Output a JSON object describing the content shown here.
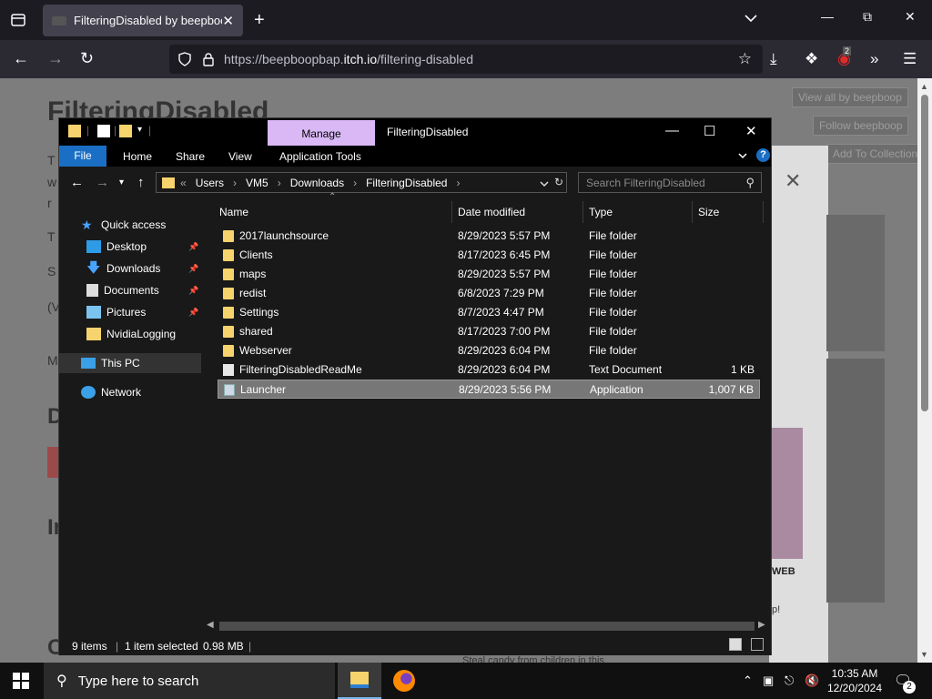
{
  "browser": {
    "tab_title": "FilteringDisabled by beepboop",
    "tab_close": "✕",
    "new_tab": "+",
    "url_prefix": "https://beepboopbap.",
    "url_host": "itch.io",
    "url_path": "/filtering-disabled",
    "extension_badge": "2"
  },
  "webpage": {
    "heading": "FilteringDisabled",
    "view_all_button": "View all by beepboop",
    "follow_button": "Follow beepboop",
    "add_collection_button": "Add To Collection",
    "modal_close": "✕",
    "web_label": "WEB",
    "letters": [
      "T",
      "w",
      "r",
      "T",
      "S",
      "(V",
      "M"
    ],
    "big_letters": [
      "D",
      "In",
      "C"
    ],
    "text_fragment": "p!",
    "footer_text": "Steal candy from children in this"
  },
  "explorer": {
    "window_title": "FilteringDisabled",
    "manage_label": "Manage",
    "ribbon_tabs": {
      "file": "File",
      "home": "Home",
      "share": "Share",
      "view": "View",
      "application_tools": "Application Tools"
    },
    "help": "?",
    "address": {
      "prefix": "«",
      "segments": [
        "Users",
        "VM5",
        "Downloads",
        "FilteringDisabled"
      ],
      "separator": "›"
    },
    "search_placeholder": "Search FilteringDisabled",
    "nav": {
      "quick_access": "Quick access",
      "desktop": "Desktop",
      "downloads": "Downloads",
      "documents": "Documents",
      "pictures": "Pictures",
      "nvidia_logging": "NvidiaLogging",
      "this_pc": "This PC",
      "network": "Network"
    },
    "columns": {
      "name": "Name",
      "date_modified": "Date modified",
      "type": "Type",
      "size": "Size"
    },
    "files": [
      {
        "name": "2017launchsource",
        "date": "8/29/2023 5:57 PM",
        "type": "File folder",
        "size": "",
        "kind": "folder"
      },
      {
        "name": "Clients",
        "date": "8/17/2023 6:45 PM",
        "type": "File folder",
        "size": "",
        "kind": "folder"
      },
      {
        "name": "maps",
        "date": "8/29/2023 5:57 PM",
        "type": "File folder",
        "size": "",
        "kind": "folder"
      },
      {
        "name": "redist",
        "date": "6/8/2023 7:29 PM",
        "type": "File folder",
        "size": "",
        "kind": "folder"
      },
      {
        "name": "Settings",
        "date": "8/7/2023 4:47 PM",
        "type": "File folder",
        "size": "",
        "kind": "folder"
      },
      {
        "name": "shared",
        "date": "8/17/2023 7:00 PM",
        "type": "File folder",
        "size": "",
        "kind": "folder"
      },
      {
        "name": "Webserver",
        "date": "8/29/2023 6:04 PM",
        "type": "File folder",
        "size": "",
        "kind": "folder"
      },
      {
        "name": "FilteringDisabledReadMe",
        "date": "8/29/2023 6:04 PM",
        "type": "Text Document",
        "size": "1 KB",
        "kind": "doc"
      },
      {
        "name": "Launcher",
        "date": "8/29/2023 5:56 PM",
        "type": "Application",
        "size": "1,007 KB",
        "kind": "app",
        "selected": true
      }
    ],
    "status": {
      "items": "9 items",
      "selected": "1 item selected",
      "size": "0.98 MB"
    }
  },
  "taskbar": {
    "search_placeholder": "Type here to search",
    "time": "10:35 AM",
    "date": "12/20/2024",
    "notification_count": "2"
  }
}
